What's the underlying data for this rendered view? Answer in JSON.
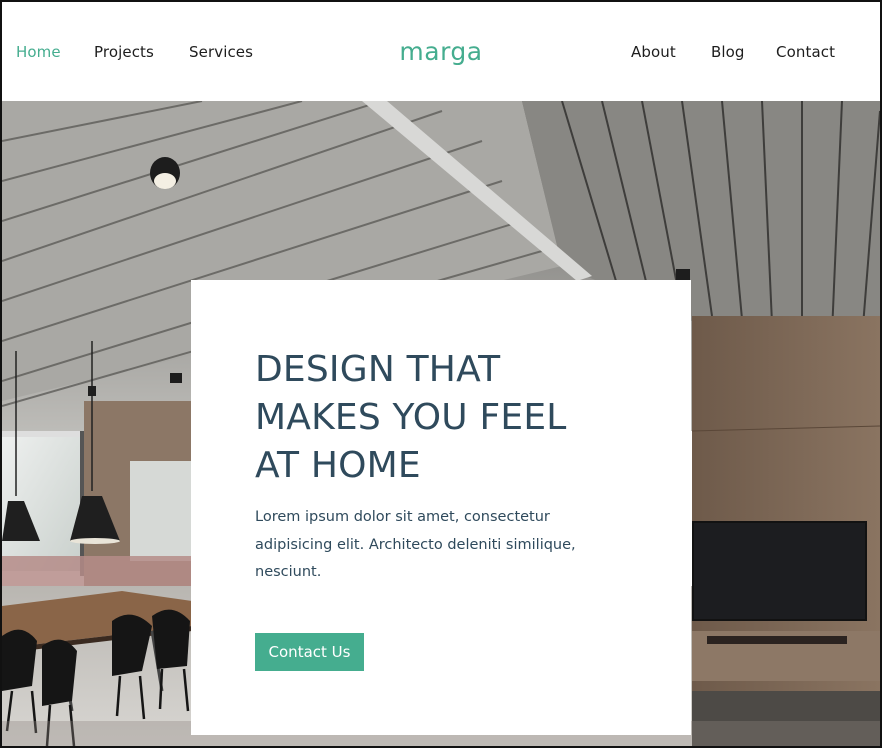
{
  "nav": {
    "left": [
      {
        "label": "Home",
        "active": true
      },
      {
        "label": "Projects",
        "active": false
      },
      {
        "label": "Services",
        "active": false
      }
    ],
    "brand": "marga",
    "right": [
      {
        "label": "About"
      },
      {
        "label": "Blog"
      },
      {
        "label": "Contact"
      }
    ]
  },
  "hero": {
    "heading_lines": [
      "DESIGN THAT",
      "MAKES YOU FEEL",
      "AT HOME"
    ],
    "body": "Lorem ipsum dolor sit amet, consectetur adipisicing elit. Architecto deleniti similique, nesciunt.",
    "cta_label": "Contact Us",
    "background_image": "modern-interior-dining-room"
  },
  "colors": {
    "accent": "#45ad8f",
    "heading_text": "#2f4a5c",
    "nav_text": "#1e1e1e"
  }
}
